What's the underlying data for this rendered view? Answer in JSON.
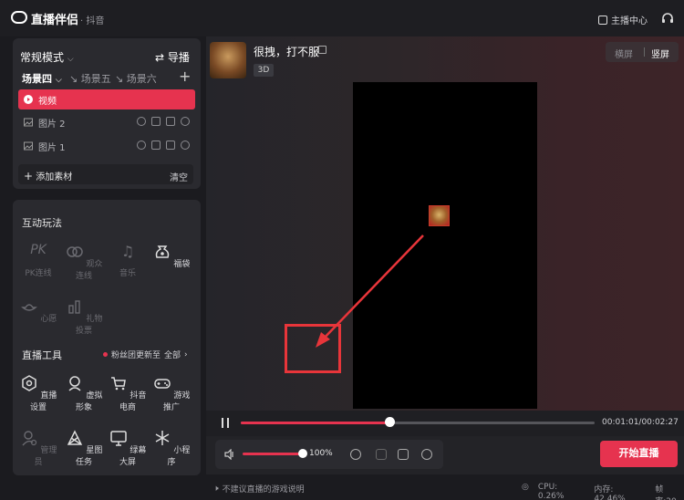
{
  "app": {
    "title": "直播伴侣",
    "subtitle": "· 抖音",
    "host_center": "主播中心"
  },
  "left": {
    "mode": "常规模式",
    "guide": "导播",
    "scenes": [
      "场景四",
      "场景五",
      "场景六"
    ],
    "layers": [
      {
        "label": "视频",
        "active": true
      },
      {
        "label": "图片 2",
        "active": false
      },
      {
        "label": "图片 1",
        "active": false
      }
    ],
    "add_material": "添加素材",
    "clear": "清空",
    "interactive": {
      "title": "互动玩法",
      "items": [
        "PK连线",
        "观众连线",
        "音乐",
        "福袋",
        "心愿",
        "礼物投票"
      ]
    },
    "tools": {
      "title": "直播工具",
      "notice": "粉丝团更新至",
      "all": "全部",
      "items": [
        "直播设置",
        "虚拟形象",
        "抖音电商",
        "游戏推广",
        "管理员",
        "星图任务",
        "绿幕大屏",
        "小程序"
      ]
    }
  },
  "main": {
    "streamer_name": "很拽，打不服",
    "badge": "3D",
    "orientation": {
      "horizontal": "横屏",
      "vertical": "竖屏"
    },
    "playback": {
      "progress": 0.42,
      "time": "00:01:01/00:02:27"
    },
    "volume": {
      "level": 1.0,
      "label": "100%"
    },
    "start_button": "开始直播",
    "hint": "不建议直播的游戏说明",
    "stats": {
      "cpu": "CPU: 0.26%",
      "mem": "内存: 42.46%",
      "fps": "帧率:20"
    }
  },
  "colors": {
    "accent": "#e6334f",
    "annotation": "#e8353a"
  }
}
